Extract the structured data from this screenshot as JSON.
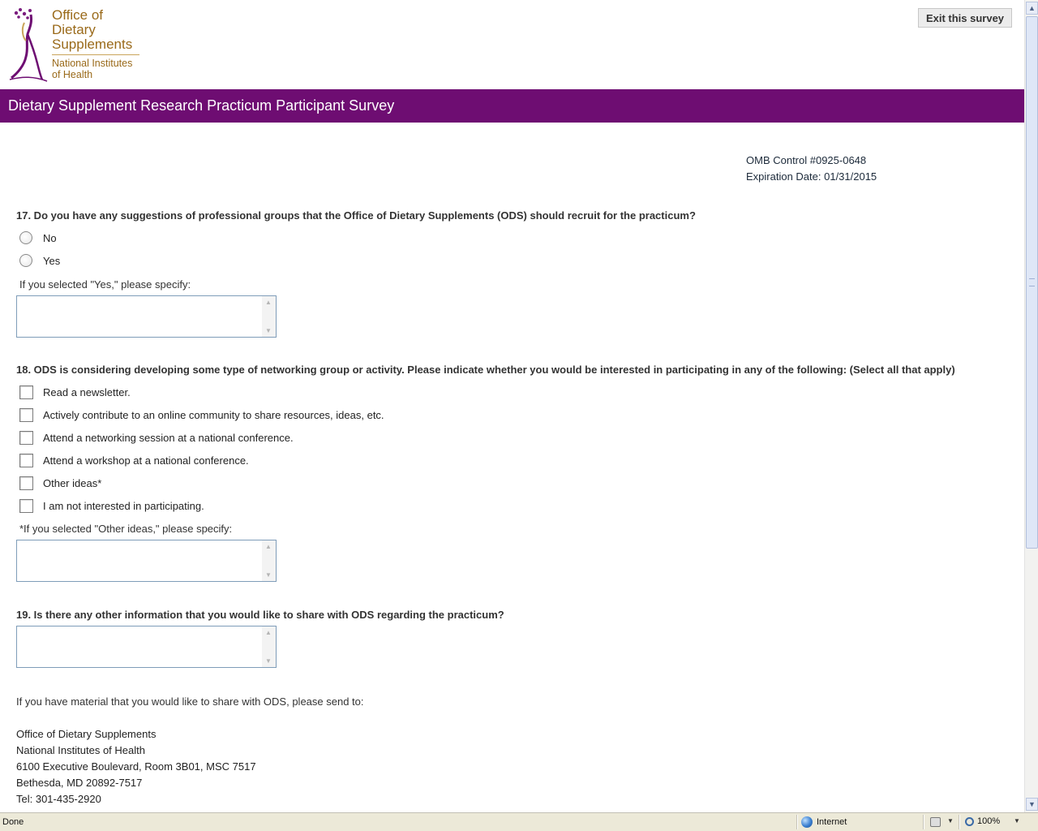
{
  "header": {
    "logo_lines": [
      "Office of",
      "Dietary",
      "Supplements",
      "National Institutes",
      "of Health"
    ],
    "exit_button": "Exit this survey",
    "survey_title": "Dietary Supplement Research Practicum Participant Survey"
  },
  "omb": {
    "control": "OMB Control #0925-0648",
    "expiration": "Expiration Date: 01/31/2015"
  },
  "q17": {
    "text": "17. Do you have any suggestions of professional groups that the Office of Dietary Supplements (ODS) should recruit for the practicum?",
    "options": [
      "No",
      "Yes"
    ],
    "specify_label": "If you selected \"Yes,\" please specify:"
  },
  "q18": {
    "text": "18. ODS is considering developing some type of networking group or activity. Please indicate whether you would be interested in participating in any of the following: (Select all that apply)",
    "options": [
      "Read a newsletter.",
      "Actively contribute to an online community to share resources, ideas, etc.",
      "Attend a networking session at a national conference.",
      "Attend a workshop at a national conference.",
      "Other ideas*",
      "I am not interested in participating."
    ],
    "specify_label": "*If you selected \"Other ideas,\" please specify:"
  },
  "q19": {
    "text": "19. Is there any other information that you would like to share with ODS regarding the practicum?"
  },
  "footer": {
    "share_text": "If you have material that you would like to share with ODS, please send to:",
    "address": [
      "Office of Dietary Supplements",
      "National Institutes of Health",
      "6100 Executive Boulevard, Room 3B01, MSC 7517",
      "Bethesda, MD 20892-7517",
      "Tel: 301-435-2920"
    ]
  },
  "statusbar": {
    "status": "Done",
    "zone": "Internet",
    "zoom": "100%"
  },
  "colors": {
    "title_bar": "#6e0d72",
    "logo_text": "#9a6a1a"
  }
}
